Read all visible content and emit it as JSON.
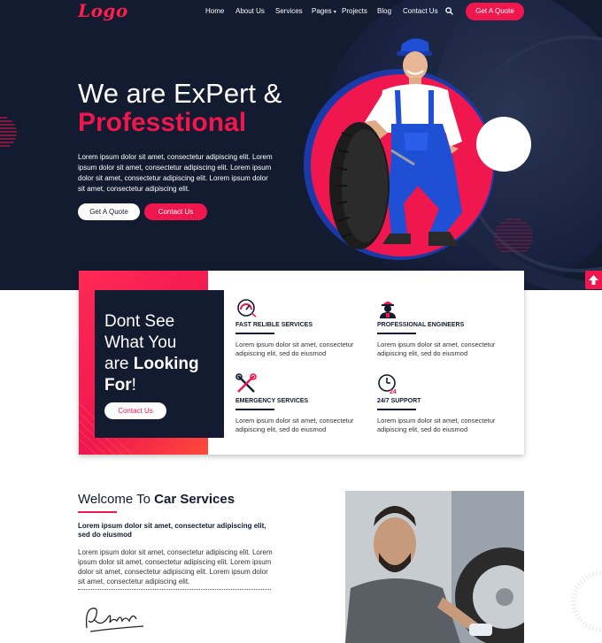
{
  "nav": {
    "logo": "Logo",
    "links": [
      "Home",
      "About Us",
      "Services",
      "Pages",
      "Projects",
      "Blog",
      "Contact Us"
    ],
    "quote_button": "Get A Quote",
    "search_icon": "search-icon"
  },
  "hero": {
    "title_line1": "We are ExPert &",
    "title_line2": "Professtional",
    "description": "Lorem ipsum dolor sit amet, consectetur adipiscing elit. Lorem ipsum dolor sit amet, consectetur adipiscing elit. Lorem ipsum dolor sit amet, consectetur adipiscing elit. Lorem ipsum dolor sit amet, consectetur adipiscing elit.",
    "btn_quote": "Get A Quote",
    "btn_contact": "Contact Us"
  },
  "cta": {
    "line1": "Dont See",
    "line2": "What You",
    "line3a": "are ",
    "line3b": "Looking",
    "line4a": "For",
    "line4b": "!",
    "button": "Contact Us"
  },
  "services": [
    {
      "name": "FAST RELIBLE SERVICES",
      "desc": "Lorem ipsum dolor sit amet, consectetur adipiscing elit, sed do eiusmod",
      "icon": "speedometer-icon"
    },
    {
      "name": "PROFESSIONAL ENGINEERS",
      "desc": "Lorem ipsum dolor sit amet, consectetur adipiscing elit, sed do eiusmod",
      "icon": "engineer-icon"
    },
    {
      "name": "EMERGENCY SERVICES",
      "desc": "Lorem ipsum dolor sit amet, consectetur adipiscing elit, sed do eiusmod",
      "icon": "tools-icon"
    },
    {
      "name": "24/7 SUPPORT",
      "desc": "Lorem ipsum dolor sit amet, consectetur adipiscing elit, sed do eiusmod",
      "icon": "clock-24-icon"
    }
  ],
  "welcome": {
    "title_a": "Welcome To ",
    "title_b": "Car Services",
    "subtitle": "Lorem ipsum dolor sit amet, consectetur adipiscing elit, sed do eiusmod",
    "text": "Lorem ipsum dolor sit amet, consectetur adipiscing elit. Lorem ipsum dolor sit amet, consectetur adipiscing elit. Lorem ipsum dolor sit amet, consectetur adipiscing elit. Lorem ipsum dolor sit amet, consectetur adipiscing elit."
  },
  "colors": {
    "accent": "#f0164e",
    "dark": "#131b30",
    "blue": "#1a3aa8"
  }
}
